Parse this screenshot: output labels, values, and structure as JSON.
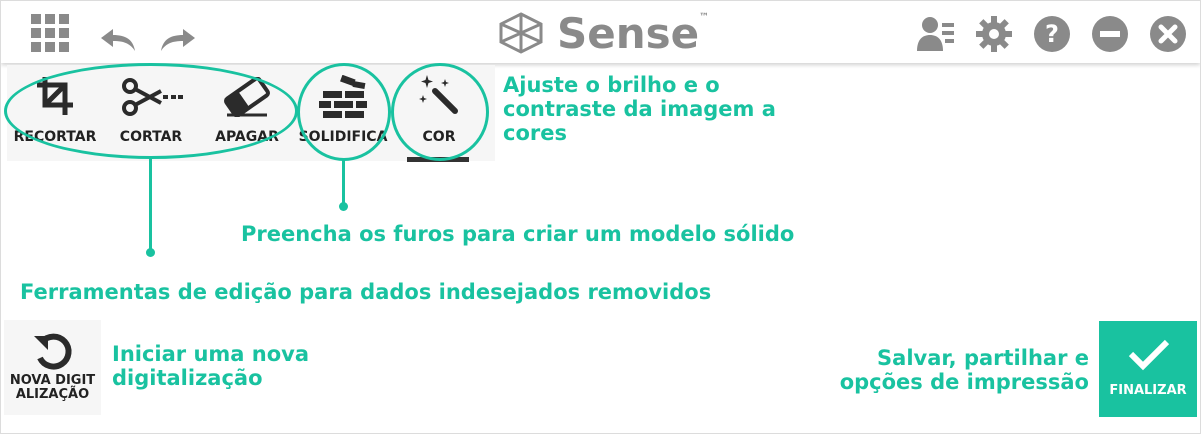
{
  "app": {
    "name": "Sense",
    "trademark": "™"
  },
  "header": {
    "icons": [
      "apps-grid-icon",
      "undo-icon",
      "redo-icon",
      "user-list-icon",
      "gear-icon",
      "help-icon",
      "minimize-icon",
      "close-icon"
    ]
  },
  "toolbar": {
    "tools": [
      {
        "label": "RECORTAR",
        "icon": "crop-icon"
      },
      {
        "label": "CORTAR",
        "icon": "scissors-icon"
      },
      {
        "label": "APAGAR",
        "icon": "eraser-icon"
      },
      {
        "label": "SOLIDIFICA",
        "icon": "brick-wall-icon"
      },
      {
        "label": "COR",
        "icon": "magic-wand-icon",
        "active": true
      }
    ]
  },
  "callouts": {
    "color": "Ajuste o brilho e o contraste da imagem a cores",
    "solidify": "Preencha os furos para criar um modelo sólido",
    "edit_tools": "Ferramentas de edição para dados indesejados removidos",
    "new_scan": "Iniciar uma nova digitalização",
    "finalize": "Salvar, partilhar e opções de impressão"
  },
  "buttons": {
    "new_scan": "NOVA DIGITALIZAÇÃO",
    "finalize": "FINALIZAR"
  },
  "colors": {
    "accent": "#19c2a0",
    "icon_gray": "#8a8a8a",
    "toolbar_bg": "#f6f6f6"
  }
}
